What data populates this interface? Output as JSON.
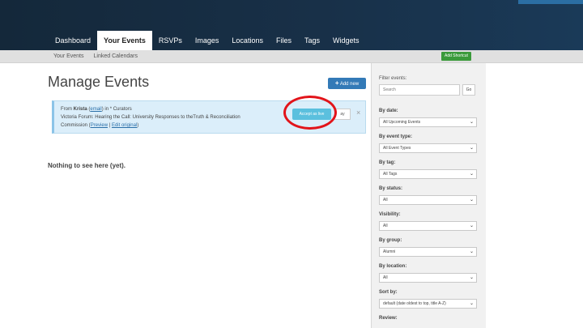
{
  "nav": {
    "tabs": [
      {
        "label": "Dashboard"
      },
      {
        "label": "Your Events",
        "active": true
      },
      {
        "label": "RSVPs"
      },
      {
        "label": "Images"
      },
      {
        "label": "Locations"
      },
      {
        "label": "Files"
      },
      {
        "label": "Tags"
      },
      {
        "label": "Widgets"
      }
    ]
  },
  "subnav": {
    "tabs": [
      {
        "label": "Your Events"
      },
      {
        "label": "Linked Calendars"
      }
    ],
    "add_shortcut": "Add Shortcut"
  },
  "page": {
    "title": "Manage Events",
    "add_new": "Add new",
    "empty_message": "Nothing to see here (yet)."
  },
  "invite": {
    "from_prefix": "From ",
    "from_name": "Krista",
    "email_link": "email",
    "in_text": " in * Curators",
    "event_title": "Victoria Forum: Hearing the Call: University Responses to theTruth & Reconciliation",
    "event_title_cont": "Commission",
    "preview_link": "Preview",
    "edit_link": "Edit original",
    "accept": "Accept as live",
    "reject": "Reject",
    "reject_visible": "ay",
    "dismiss": "×"
  },
  "sidebar": {
    "filter_title": "Filter events:",
    "search_placeholder": "Search",
    "go": "Go",
    "filters": [
      {
        "label": "By date:",
        "value": "All Upcoming Events"
      },
      {
        "label": "By event type:",
        "value": "All Event Types"
      },
      {
        "label": "By tag:",
        "value": "All Tags"
      },
      {
        "label": "By status:",
        "value": "All"
      },
      {
        "label": "Visibility:",
        "value": "All"
      },
      {
        "label": "By group:",
        "value": "Alumni"
      },
      {
        "label": "By location:",
        "value": "All"
      },
      {
        "label": "Sort by:",
        "value": "default (date oldest to top, title A-Z)"
      },
      {
        "label": "Review:",
        "value": ""
      }
    ]
  },
  "colors": {
    "accent": "#337ab7",
    "info": "#5bc0de",
    "success": "#3a9a3a",
    "highlight": "#e2141a"
  }
}
